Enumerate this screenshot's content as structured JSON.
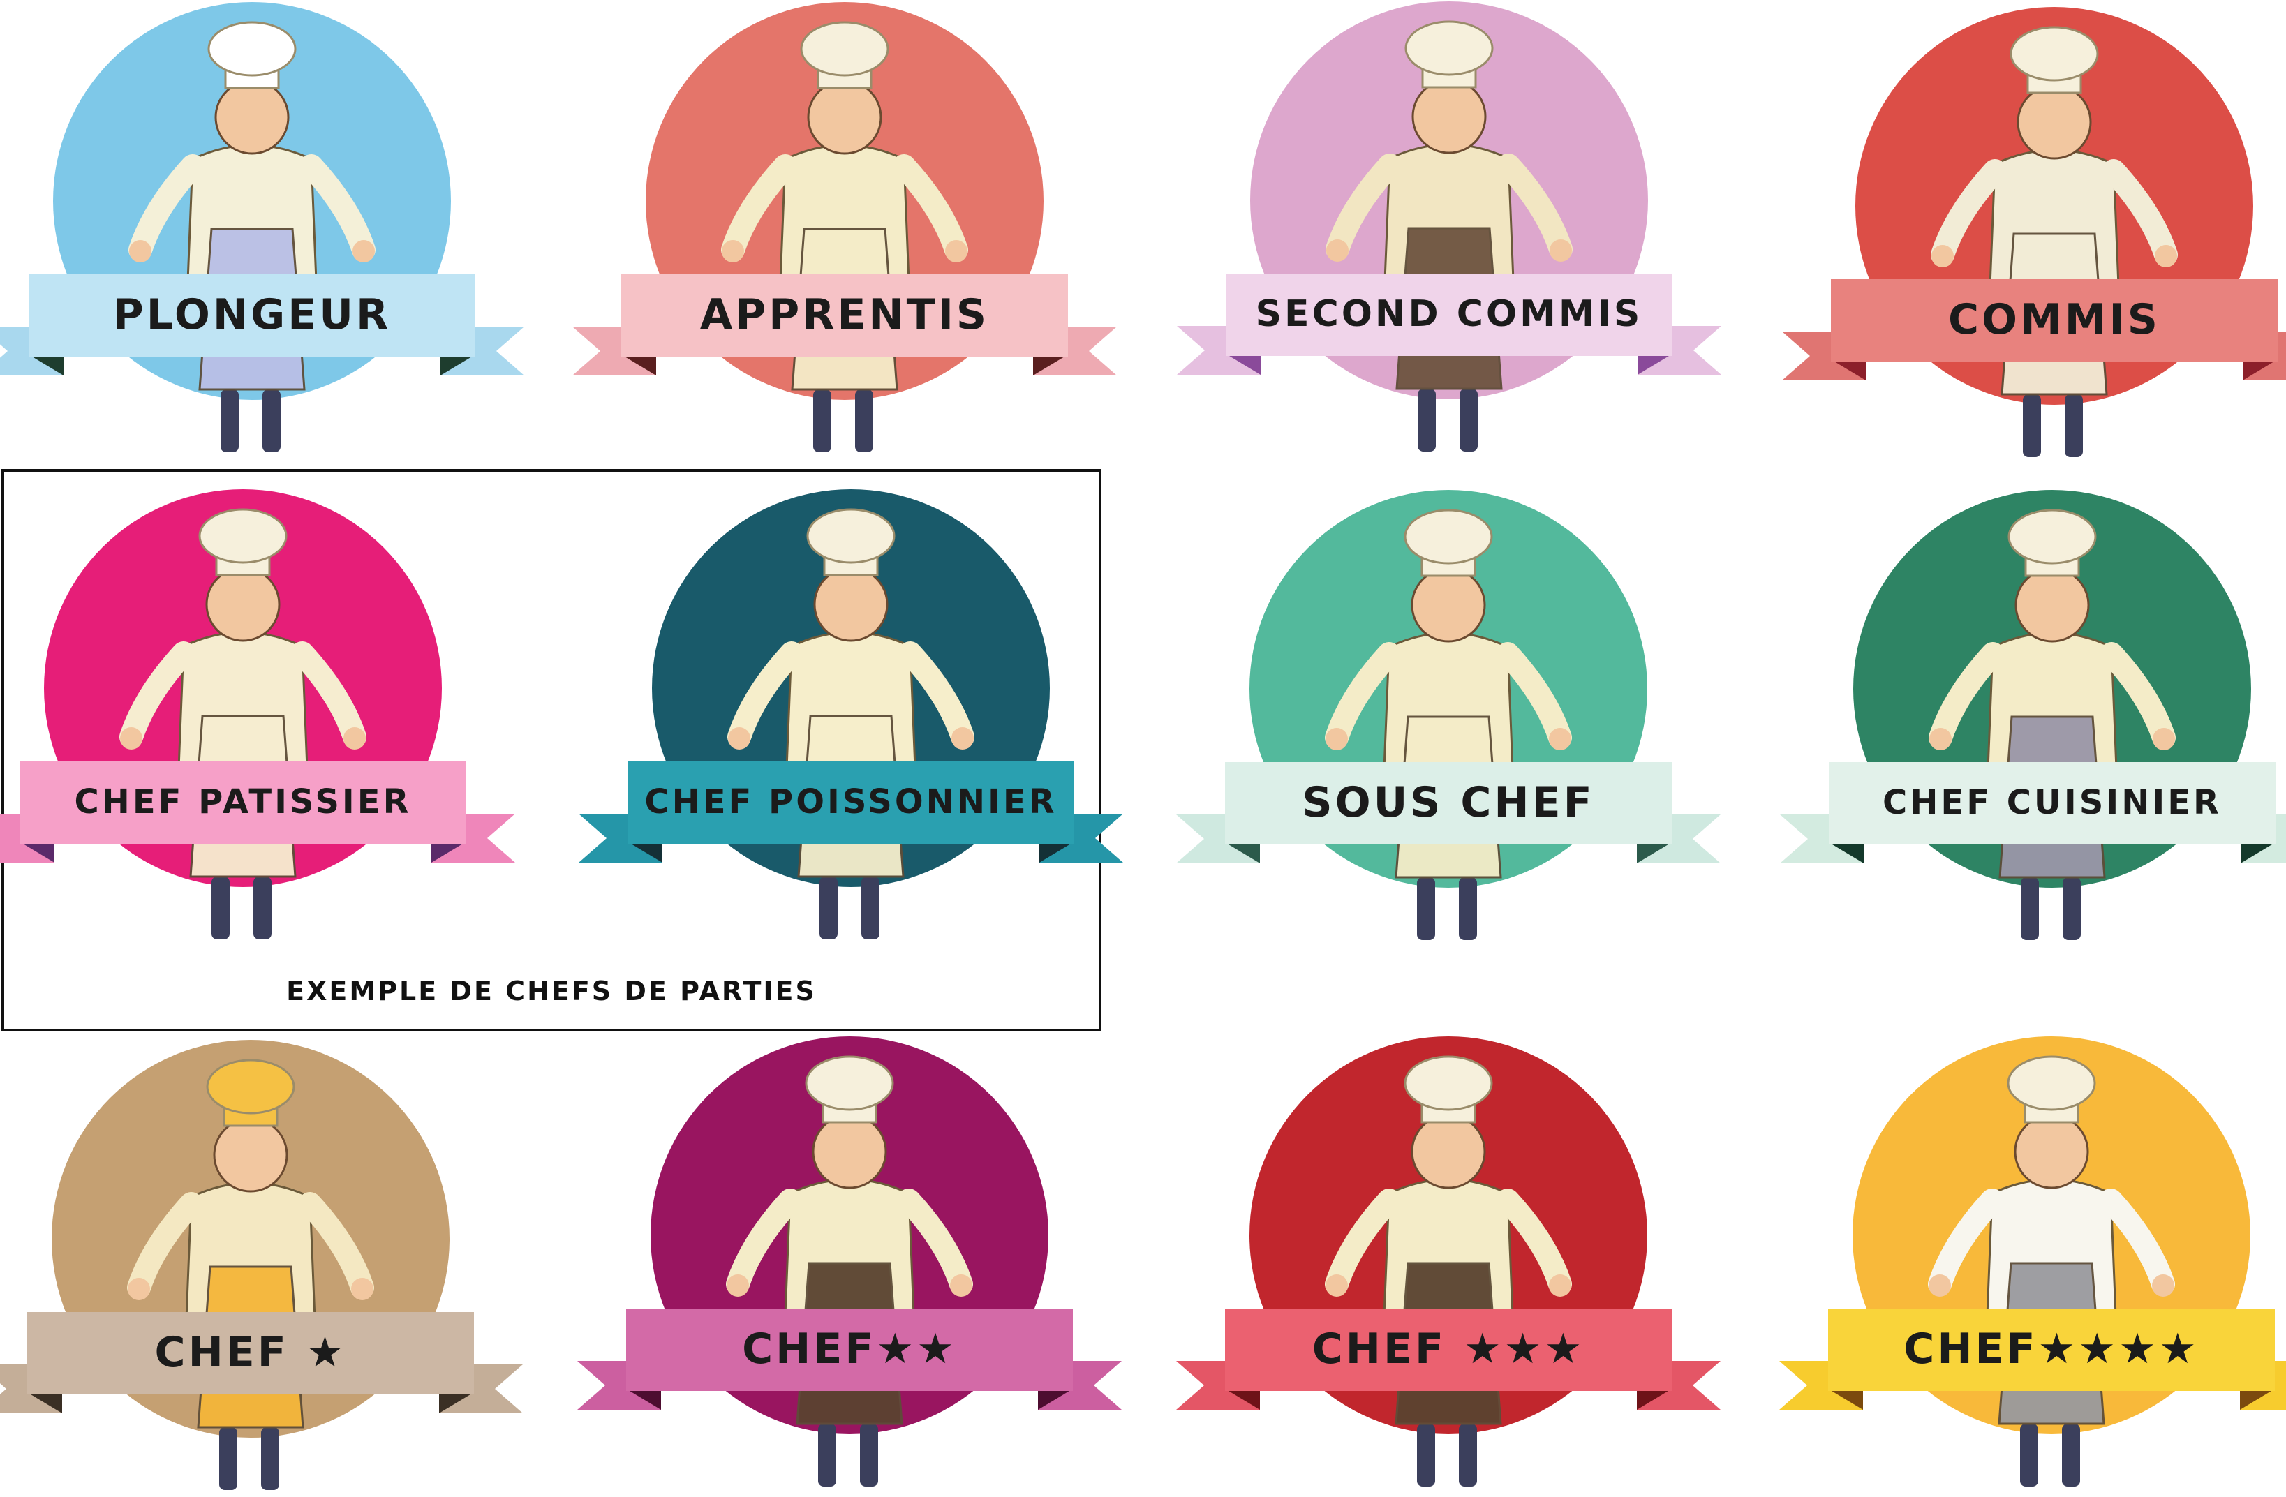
{
  "badges": [
    {
      "label": "PLONGEUR",
      "circle": "#7ec8e8",
      "ribbon": "#bfe4f4",
      "tail": "#a9d8ee",
      "fold": "#1e3d2e",
      "uniform": "#f4f0d8",
      "apron": "#b9bfe6",
      "hat": "#ffffff"
    },
    {
      "label": "APPRENTIS",
      "circle": "#e4756a",
      "ribbon": "#f6c2c6",
      "tail": "#eeaab2",
      "fold": "#5a1f1f",
      "uniform": "#f4ecc8",
      "apron": "#f4ecc8",
      "hat": "#f6f0dc"
    },
    {
      "label": "SECOND COMMIS",
      "circle": "#dda7cd",
      "ribbon": "#f0d4ea",
      "tail": "#e6c0e0",
      "fold": "#8a4a9a",
      "uniform": "#f2e6c2",
      "apron": "#6e5440",
      "hat": "#f6f0dc"
    },
    {
      "label": "COMMIS",
      "circle": "#dc4e47",
      "ribbon": "#e8827e",
      "tail": "#e07572",
      "fold": "#8c1f2a",
      "uniform": "#f2ecd6",
      "apron": "#f2ecd6",
      "hat": "#f6f0dc"
    },
    {
      "label": "CHEF PATISSIER",
      "circle": "#e61e78",
      "ribbon": "#f6a0c8",
      "tail": "#ef86ba",
      "fold": "#5b2a6a",
      "uniform": "#f6edd0",
      "apron": "#f6edd0",
      "hat": "#f6f0dc"
    },
    {
      "label": "CHEF POISSONNIER",
      "circle": "#195a6a",
      "ribbon": "#2aa0b0",
      "tail": "#2596a8",
      "fold": "#143036",
      "uniform": "#f6eecb",
      "apron": "#f6eecb",
      "hat": "#f6f0dc"
    },
    {
      "label": "SOUS CHEF",
      "circle": "#53b99c",
      "ribbon": "#dcefe8",
      "tail": "#cfe9e0",
      "fold": "#2b5a4b",
      "uniform": "#f4ecc8",
      "apron": "#f4ecc8",
      "hat": "#f6f0dc"
    },
    {
      "label": "CHEF CUISINIER",
      "circle": "#2e8464",
      "ribbon": "#e2f1ea",
      "tail": "#d3ebe0",
      "fold": "#14392b",
      "uniform": "#f4ecc8",
      "apron": "#9a96a8",
      "hat": "#f6f0dc"
    },
    {
      "label": "CHEF ★",
      "circle": "#c5a072",
      "ribbon": "#ccb7a4",
      "tail": "#c4ae98",
      "fold": "#3a2f24",
      "uniform": "#f4e8c2",
      "apron": "#f4b63a",
      "hat": "#f5c144"
    },
    {
      "label": "CHEF★★",
      "circle": "#991560",
      "ribbon": "#d36aa7",
      "tail": "#cc5fa0",
      "fold": "#4d0d30",
      "uniform": "#f4ecc8",
      "apron": "#5a4330",
      "hat": "#f6f0dc"
    },
    {
      "label": "CHEF ★★★",
      "circle": "#c1262d",
      "ribbon": "#eb6170",
      "tail": "#e45666",
      "fold": "#6e1218",
      "uniform": "#f4ecc8",
      "apron": "#5a4330",
      "hat": "#f6f0dc"
    },
    {
      "label": "CHEF★★★★",
      "circle": "#f8b93a",
      "ribbon": "#f9d43a",
      "tail": "#f7cc2e",
      "fold": "#7b4a0e",
      "uniform": "#f8f6ee",
      "apron": "#9a9a9e",
      "hat": "#f6f0dc"
    }
  ],
  "caption": "EXEMPLE DE CHEFS DE PARTIES"
}
